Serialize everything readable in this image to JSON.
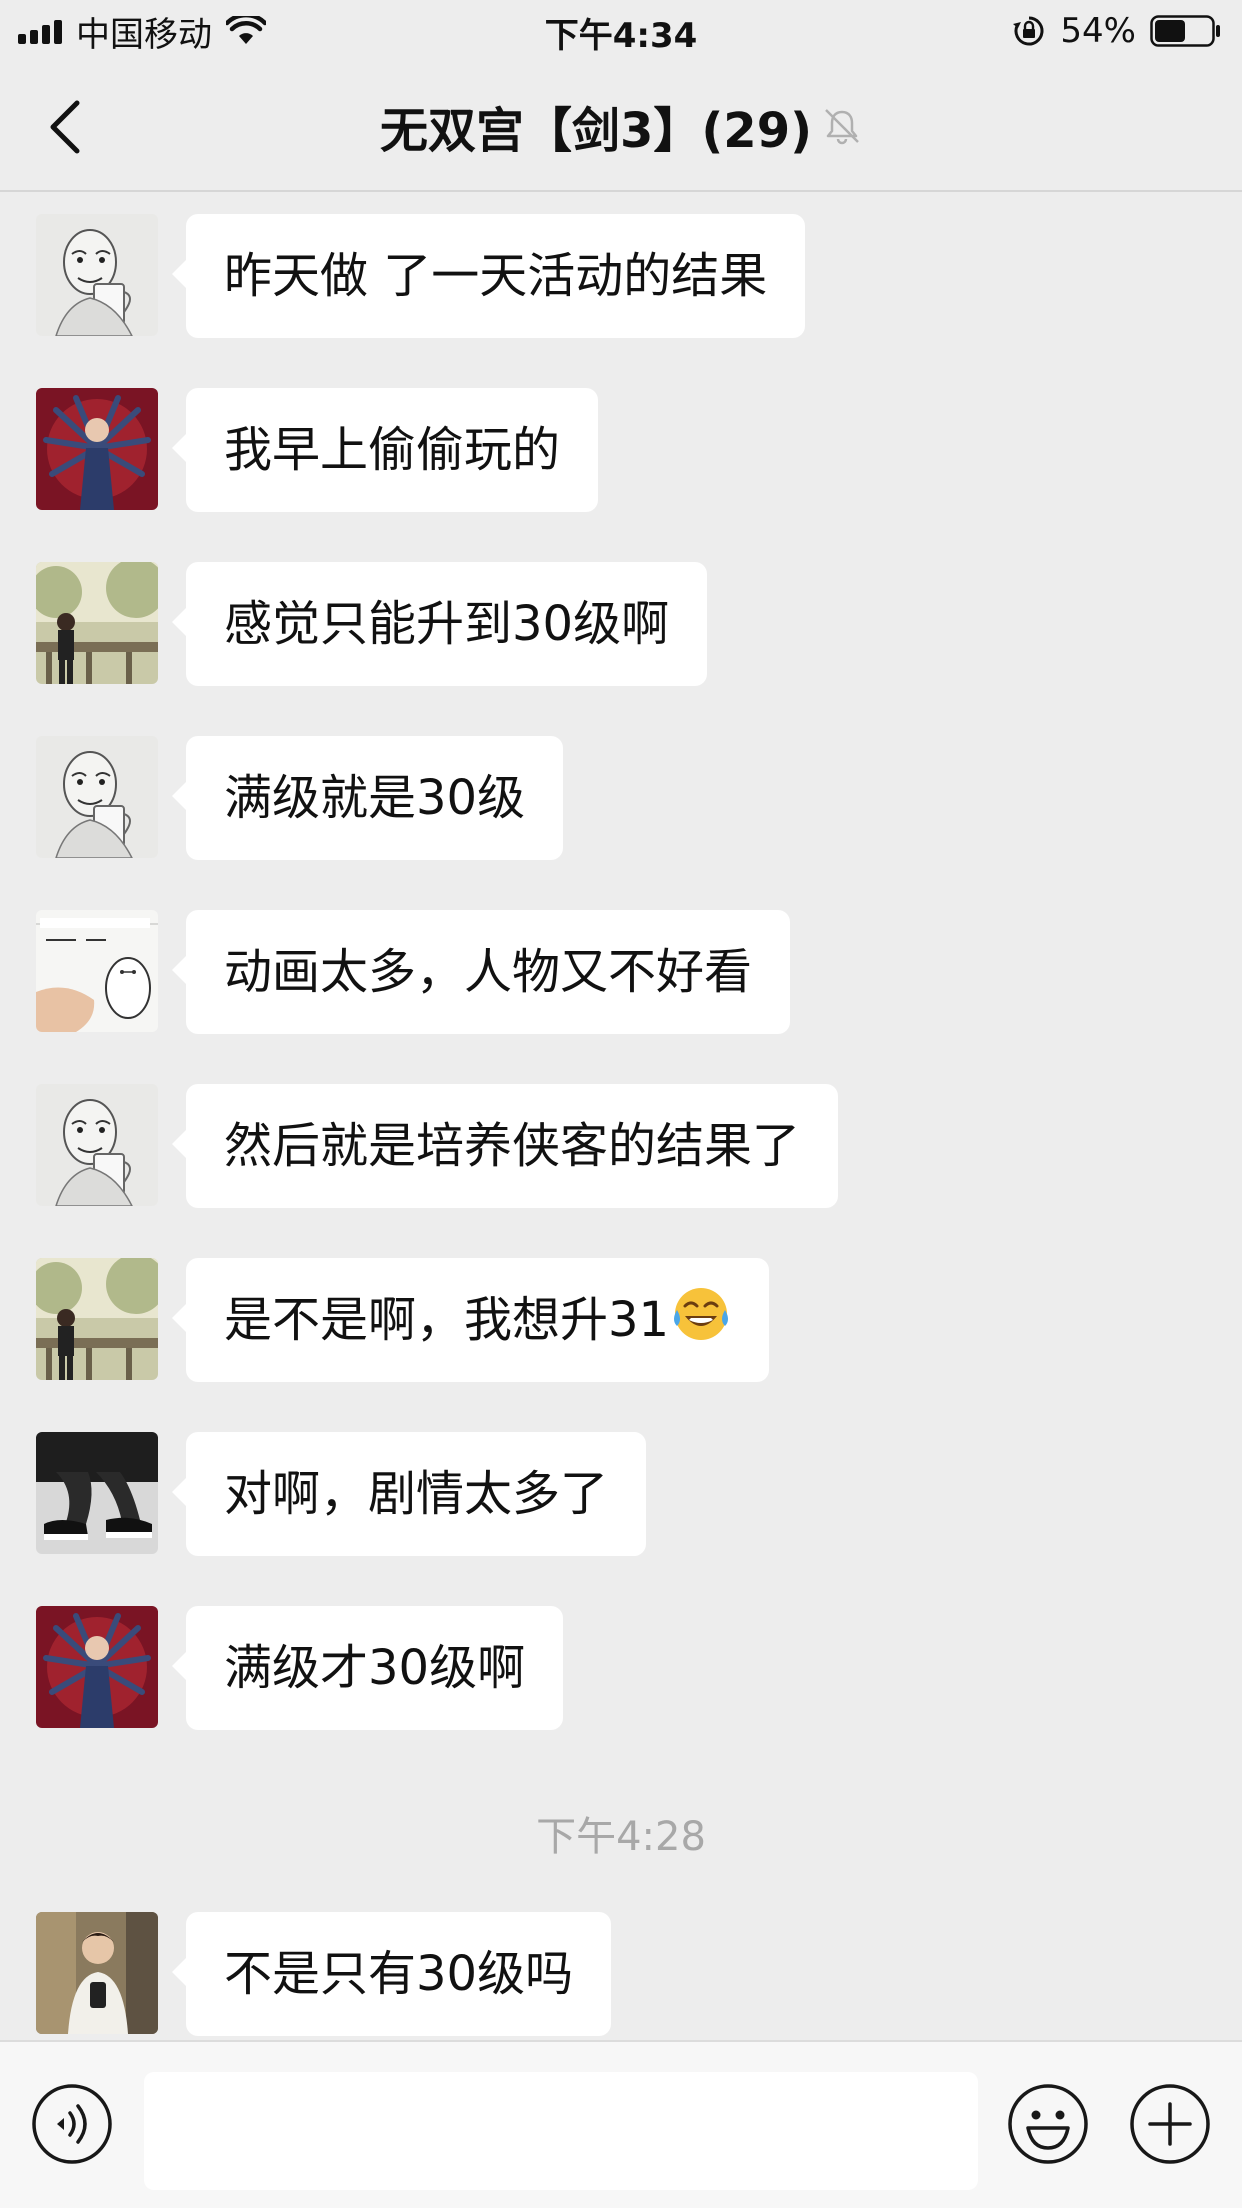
{
  "status_bar": {
    "carrier": "中国移动",
    "time": "下午4:34",
    "battery": "54%",
    "battery_level": 0.54
  },
  "header": {
    "title": "无双宫【剑3】(29)",
    "muted_icon": "bell-muted-icon"
  },
  "messages": [
    {
      "avatar": "sketch-man-beer",
      "text": "昨天做 了一天活动的结果"
    },
    {
      "avatar": "red-multiarm-figure",
      "text": "我早上偷偷玩的"
    },
    {
      "avatar": "boy-on-bridge",
      "text": "感觉只能升到30级啊"
    },
    {
      "avatar": "sketch-man-beer",
      "text": "满级就是30级"
    },
    {
      "avatar": "baymax-drawing",
      "text": "动画太多，人物又不好看"
    },
    {
      "avatar": "sketch-man-beer",
      "text": "然后就是培养侠客的结果了"
    },
    {
      "avatar": "boy-on-bridge",
      "text": "是不是啊，我想升31",
      "emoji": "tears-of-joy-emoji"
    },
    {
      "avatar": "sneakers-photo",
      "text": "对啊，剧情太多了"
    },
    {
      "avatar": "red-multiarm-figure",
      "text": "满级才30级啊"
    }
  ],
  "timestamp": "下午4:28",
  "messages_after": [
    {
      "avatar": "selfie-boy",
      "text": "不是只有30级吗"
    }
  ],
  "input_bar": {
    "voice_icon": "voice-icon",
    "emoji_icon": "emoji-icon",
    "plus_icon": "plus-icon",
    "input_value": ""
  },
  "colors": {
    "background": "#ededed",
    "bubble": "#ffffff",
    "timestamp": "#a8a8a8"
  }
}
